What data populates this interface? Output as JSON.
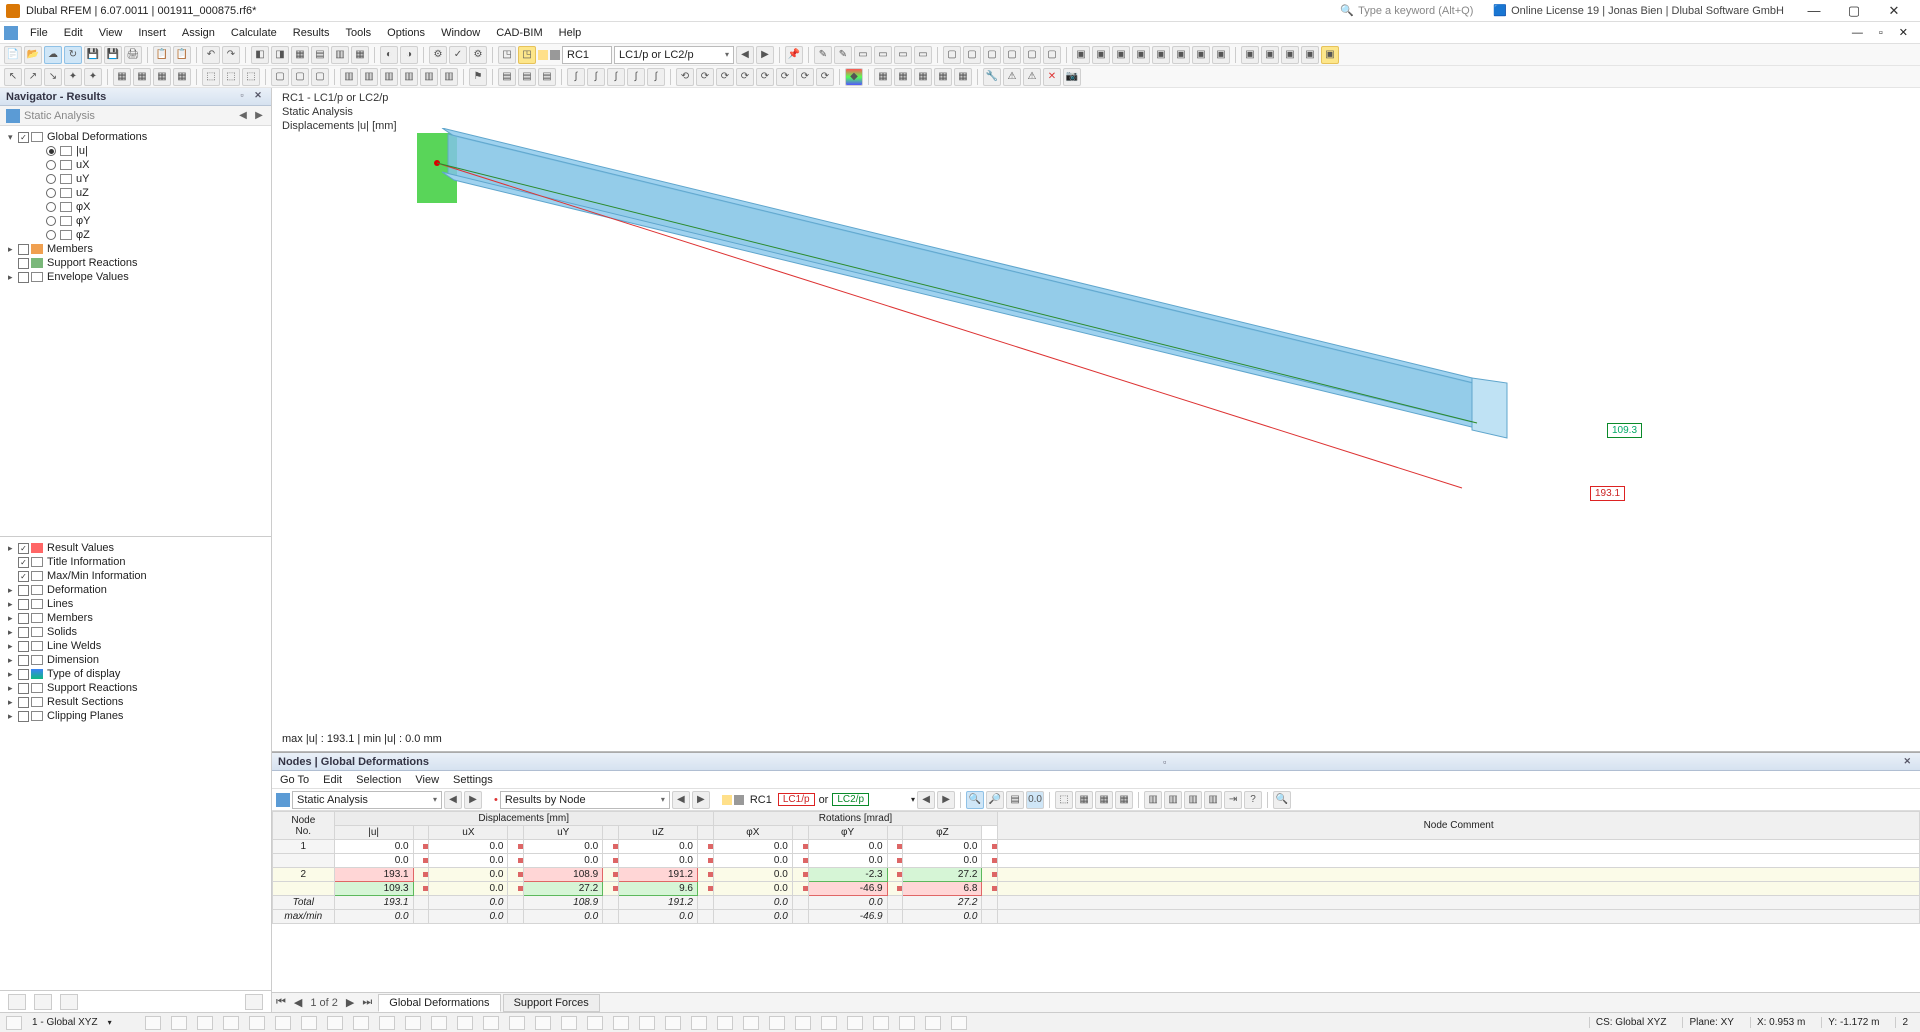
{
  "title": "Dlubal RFEM | 6.07.0011 | 001911_000875.rf6*",
  "search_hint": "Type a keyword (Alt+Q)",
  "license": "Online License 19 | Jonas Bien | Dlubal Software GmbH",
  "menu": [
    "File",
    "Edit",
    "View",
    "Insert",
    "Assign",
    "Calculate",
    "Results",
    "Tools",
    "Options",
    "Window",
    "CAD-BIM",
    "Help"
  ],
  "toolbar_rc_label": "RC1",
  "toolbar_lc_combo": "LC1/p or LC2/p",
  "navigator_title": "Navigator - Results",
  "analysis_type": "Static Analysis",
  "tree": {
    "global_def": "Global Deformations",
    "u_items": [
      "|u|",
      "uX",
      "uY",
      "uZ",
      "φX",
      "φY",
      "φZ"
    ],
    "members": "Members",
    "support": "Support Reactions",
    "envelope": "Envelope Values",
    "lower": [
      "Result Values",
      "Title Information",
      "Max/Min Information",
      "Deformation",
      "Lines",
      "Members",
      "Solids",
      "Line Welds",
      "Dimension",
      "Type of display",
      "Support Reactions",
      "Result Sections",
      "Clipping Planes"
    ]
  },
  "viewport": {
    "line1": "RC1 - LC1/p or LC2/p",
    "line2": "Static Analysis",
    "line3": "Displacements |u| [mm]",
    "maxmin": "max |u| : 193.1 | min |u| : 0.0 mm",
    "annot_green": "109.3",
    "annot_red": "193.1"
  },
  "bottom": {
    "title": "Nodes | Global Deformations",
    "menu": [
      "Go To",
      "Edit",
      "Selection",
      "View",
      "Settings"
    ],
    "analysis": "Static Analysis",
    "results_by": "Results by Node",
    "rc": "RC1",
    "lc1": "LC1/p",
    "lc_or": "or",
    "lc2": "LC2/p",
    "headers": {
      "node": "Node\nNo.",
      "disp_group": "Displacements [mm]",
      "rot_group": "Rotations [mrad]",
      "comment": "Node Comment",
      "cols": [
        "|u|",
        "uX",
        "uY",
        "uZ",
        "φX",
        "φY",
        "φZ"
      ]
    },
    "rows": [
      {
        "node": "1",
        "u": "0.0",
        "ux": "0.0",
        "uy": "0.0",
        "uz": "0.0",
        "px": "0.0",
        "py": "0.0",
        "pz": "0.0"
      },
      {
        "node": "",
        "u": "0.0",
        "ux": "0.0",
        "uy": "0.0",
        "uz": "0.0",
        "px": "0.0",
        "py": "0.0",
        "pz": "0.0"
      },
      {
        "node": "2",
        "u": "193.1",
        "ux": "0.0",
        "uy": "108.9",
        "uz": "191.2",
        "px": "0.0",
        "py": "-2.3",
        "pz": "27.2",
        "hl": {
          "u": "red",
          "uy": "red",
          "uz": "red",
          "py": "green",
          "pz": "green"
        }
      },
      {
        "node": "",
        "u": "109.3",
        "ux": "0.0",
        "uy": "27.2",
        "uz": "9.6",
        "px": "0.0",
        "py": "-46.9",
        "pz": "6.8",
        "hl": {
          "u": "green",
          "uy": "green",
          "uz": "green",
          "py": "red",
          "pz": "red"
        }
      }
    ],
    "totals": [
      {
        "label": "Total",
        "u": "193.1",
        "ux": "0.0",
        "uy": "108.9",
        "uz": "191.2",
        "px": "0.0",
        "py": "0.0",
        "pz": "27.2"
      },
      {
        "label": "max/min",
        "u": "0.0",
        "ux": "0.0",
        "uy": "0.0",
        "uz": "0.0",
        "px": "0.0",
        "py": "-46.9",
        "pz": "0.0"
      }
    ],
    "tabs": {
      "pager": "1 of 2",
      "items": [
        "Global Deformations",
        "Support Forces"
      ],
      "active": 0
    }
  },
  "status": {
    "coord_sys": "1 - Global XYZ",
    "cs_label": "CS: Global XYZ",
    "plane": "Plane: XY",
    "x": "X: 0.953 m",
    "y": "Y: -1.172 m",
    "z": "2"
  }
}
